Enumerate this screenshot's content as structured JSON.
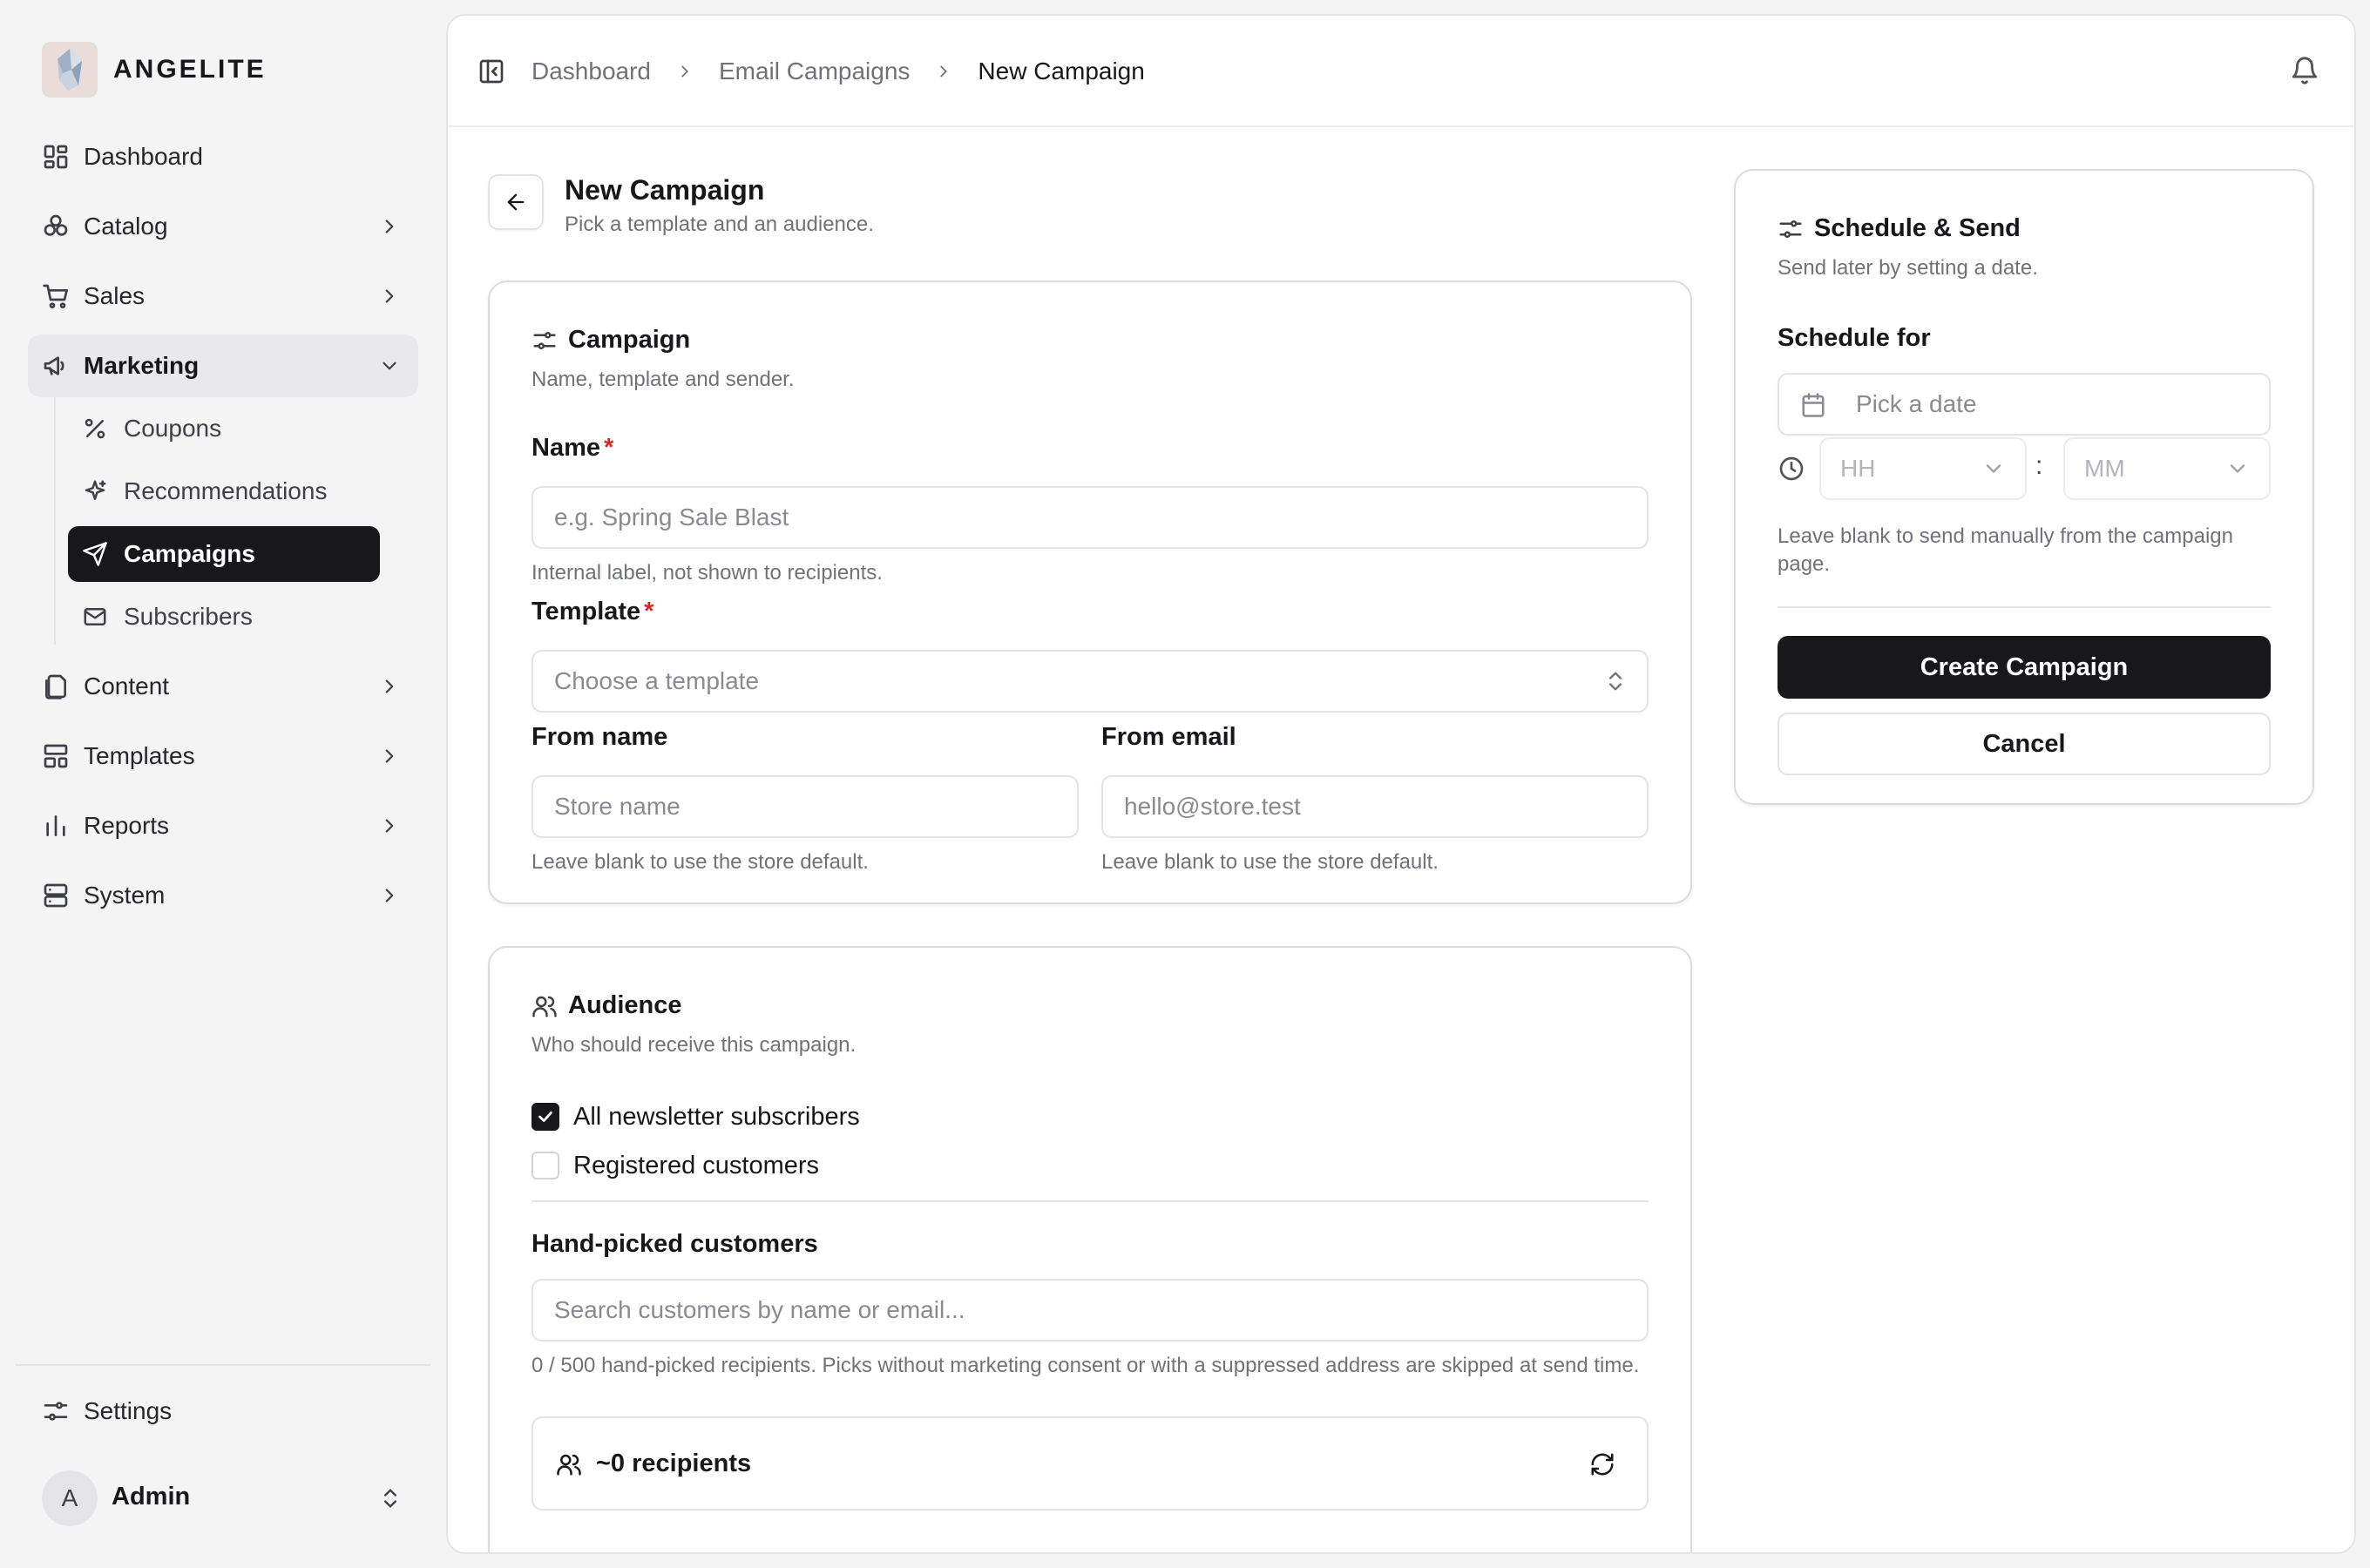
{
  "brand": {
    "name": "ANGELITE"
  },
  "sidebar": {
    "items": [
      {
        "label": "Dashboard",
        "icon": "dashboard-icon"
      },
      {
        "label": "Catalog",
        "icon": "catalog-icon"
      },
      {
        "label": "Sales",
        "icon": "cart-icon"
      },
      {
        "label": "Marketing",
        "icon": "megaphone-icon"
      },
      {
        "label": "Content",
        "icon": "files-icon"
      },
      {
        "label": "Templates",
        "icon": "layout-icon"
      },
      {
        "label": "Reports",
        "icon": "bar-chart-icon"
      },
      {
        "label": "System",
        "icon": "server-icon"
      }
    ],
    "marketing_sub": [
      {
        "label": "Coupons",
        "icon": "percent-icon"
      },
      {
        "label": "Recommendations",
        "icon": "sparkles-icon"
      },
      {
        "label": "Campaigns",
        "icon": "send-icon"
      },
      {
        "label": "Subscribers",
        "icon": "mail-icon"
      }
    ],
    "settings_label": "Settings",
    "user": {
      "initial": "A",
      "name": "Admin"
    }
  },
  "breadcrumb": {
    "items": [
      "Dashboard",
      "Email Campaigns"
    ],
    "current": "New Campaign"
  },
  "page": {
    "title": "New Campaign",
    "subtitle": "Pick a template and an audience."
  },
  "campaign_card": {
    "title": "Campaign",
    "description": "Name, template and sender.",
    "name_label": "Name",
    "name_required": "*",
    "name_placeholder": "e.g. Spring Sale Blast",
    "name_help": "Internal label, not shown to recipients.",
    "template_label": "Template",
    "template_required": "*",
    "template_placeholder": "Choose a template",
    "from_name_label": "From name",
    "from_name_placeholder": "Store name",
    "from_name_help": "Leave blank to use the store default.",
    "from_email_label": "From email",
    "from_email_placeholder": "hello@store.test",
    "from_email_help": "Leave blank to use the store default."
  },
  "audience_card": {
    "title": "Audience",
    "description": "Who should receive this campaign.",
    "options": [
      {
        "label": "All newsletter subscribers",
        "checked": true
      },
      {
        "label": "Registered customers",
        "checked": false
      }
    ],
    "handpicked_label": "Hand-picked customers",
    "handpicked_placeholder": "Search customers by name or email...",
    "handpicked_help": "0 / 500 hand-picked recipients. Picks without marketing consent or with a suppressed address are skipped at send time.",
    "recipients_text": "~0 recipients"
  },
  "schedule_card": {
    "title": "Schedule & Send",
    "description": "Send later by setting a date.",
    "schedule_label": "Schedule for",
    "date_placeholder": "Pick a date",
    "hour_placeholder": "HH",
    "time_separator": ":",
    "minute_placeholder": "MM",
    "help": "Leave blank to send manually from the campaign page.",
    "create_button": "Create Campaign",
    "cancel_button": "Cancel"
  },
  "colors": {
    "accent": "#18181b",
    "required": "#dc2626",
    "muted_text": "#71717a",
    "border": "#e4e4e7"
  }
}
